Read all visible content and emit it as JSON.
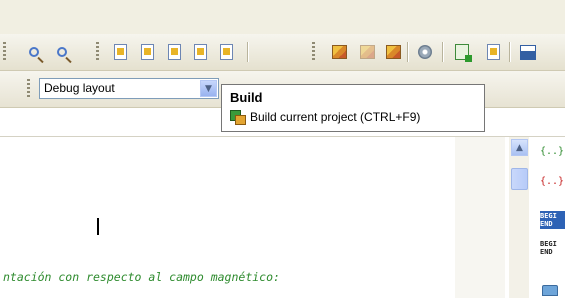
{
  "toolbar": {
    "layout_combo": {
      "value": "Debug layout"
    }
  },
  "tooltip": {
    "title": "Build",
    "text": "Build current project (CTRL+F9)"
  },
  "editor": {
    "code_line": "ntación con respecto al campo magnético:"
  },
  "side_panel": {
    "brace_green": "{..}",
    "brace_red": "{..}",
    "block1_line1": "BEGI",
    "block1_line2": "END",
    "block2_line1": "BEGI",
    "block2_line2": "END"
  }
}
